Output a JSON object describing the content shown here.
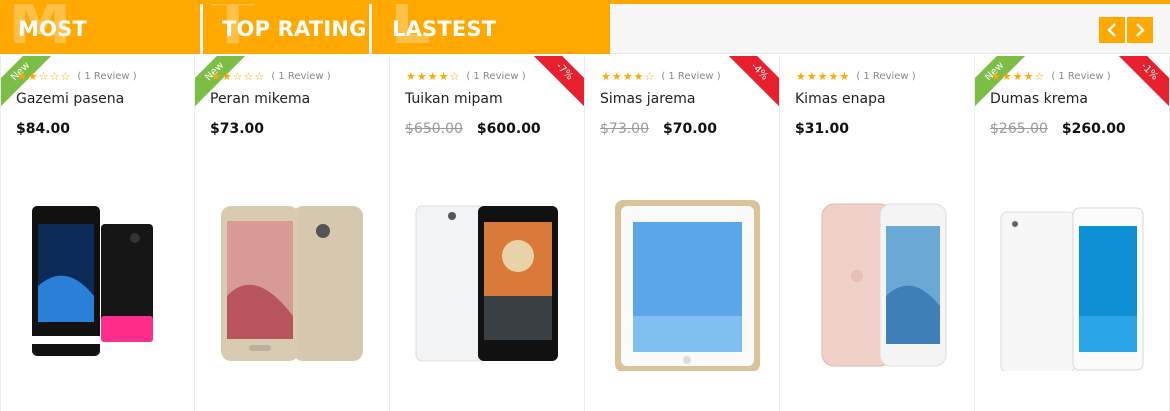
{
  "tabs": [
    {
      "label": "MOST REVIEWS",
      "ghost": "M"
    },
    {
      "label": "TOP RATING",
      "ghost": "T"
    },
    {
      "label": "LASTEST PRODUCT",
      "ghost": "L"
    }
  ],
  "colors": {
    "accent": "#ffa800",
    "new_badge": "#7cbd45",
    "sale_badge": "#e8202e"
  },
  "nav": {
    "prev_icon": "chevron-left-icon",
    "next_icon": "chevron-right-icon"
  },
  "products": [
    {
      "name": "Gazemi pasena",
      "badge": "New",
      "rating": 2,
      "reviews": "( 1 Review )",
      "old_price": "",
      "price": "$84.00",
      "sale": ""
    },
    {
      "name": "Peran mikema",
      "badge": "New",
      "rating": 2,
      "reviews": "( 1 Review )",
      "old_price": "",
      "price": "$73.00",
      "sale": ""
    },
    {
      "name": "Tuikan mipam",
      "badge": "",
      "rating": 4,
      "reviews": "( 1 Review )",
      "old_price": "$650.00",
      "price": "$600.00",
      "sale": "-7%"
    },
    {
      "name": "Simas jarema",
      "badge": "",
      "rating": 4,
      "reviews": "( 1 Review )",
      "old_price": "$73.00",
      "price": "$70.00",
      "sale": "-4%"
    },
    {
      "name": "Kimas enapa",
      "badge": "",
      "rating": 5,
      "reviews": "( 1 Review )",
      "old_price": "",
      "price": "$31.00",
      "sale": ""
    },
    {
      "name": "Dumas krema",
      "badge": "New",
      "rating": 4,
      "reviews": "( 1 Review )",
      "old_price": "$265.00",
      "price": "$260.00",
      "sale": "-1%"
    }
  ]
}
